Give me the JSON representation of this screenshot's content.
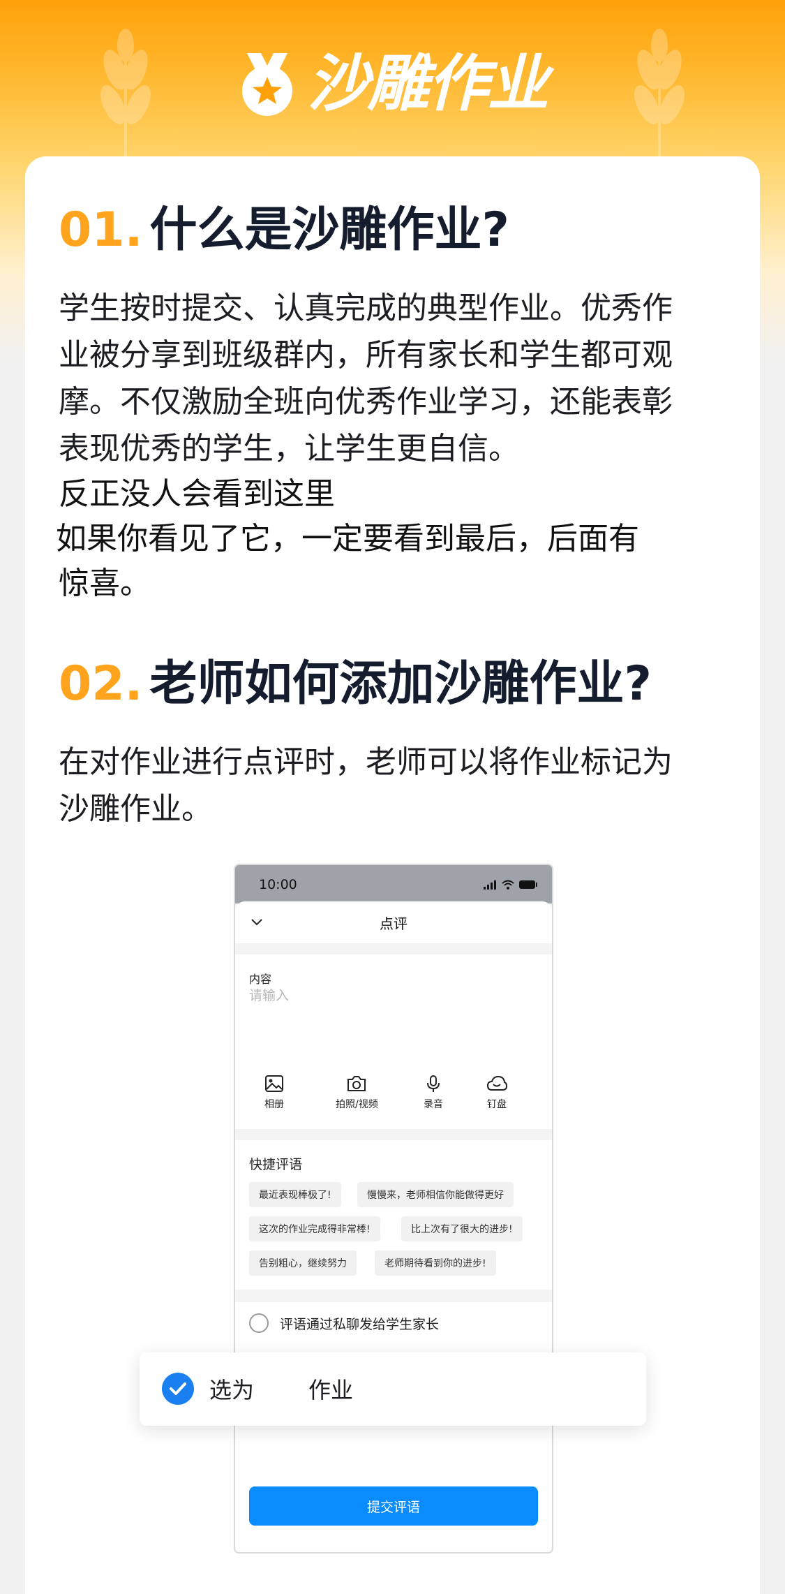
{
  "header": {
    "logo_text": "沙雕作业"
  },
  "section1": {
    "num": "01.",
    "title": "什么是沙雕作业?",
    "lines": [
      "学生按时提交、认真完成的典型作业。优秀作",
      "业被分享到班级群内，所有家长和学生都可观",
      "摩。不仅激励全班向优秀作业学习，还能表彰",
      "表现优秀的学生，让学生更自信。"
    ],
    "extra_lines": [
      "反正没人会看到这里",
      "如果你看见了它，一定要看到最后，后面有",
      "惊喜。"
    ]
  },
  "section2": {
    "num": "02.",
    "title": "老师如何添加沙雕作业?",
    "lines": [
      "在对作业进行点评时，老师可以将作业标记为",
      "沙雕作业。"
    ]
  },
  "phone": {
    "time": "10:00",
    "sheet_title": "点评",
    "content_label": "内容",
    "content_placeholder": "请输入",
    "tools": [
      {
        "icon": "image-icon",
        "label": "相册"
      },
      {
        "icon": "camera-icon",
        "label": "拍照/视频"
      },
      {
        "icon": "microphone-icon",
        "label": "录音"
      },
      {
        "icon": "cloud-drive-icon",
        "label": "钉盘"
      }
    ],
    "quick_title": "快捷评语",
    "chips": [
      "最近表现棒极了!",
      "慢慢来，老师相信你能做得更好",
      "这次的作业完成得非常棒!",
      "比上次有了很大的进步!",
      "告别粗心，继续努力",
      "老师期待看到你的进步!"
    ],
    "private_label": "评语通过私聊发给学生家长",
    "submit_label": "提交评语"
  },
  "float_option": {
    "label_before": "选为",
    "label_after": "作业",
    "checked": true
  },
  "colors": {
    "accent_orange": "#ffa41c",
    "primary_blue": "#0a8cff",
    "check_blue": "#1a7ff0"
  }
}
